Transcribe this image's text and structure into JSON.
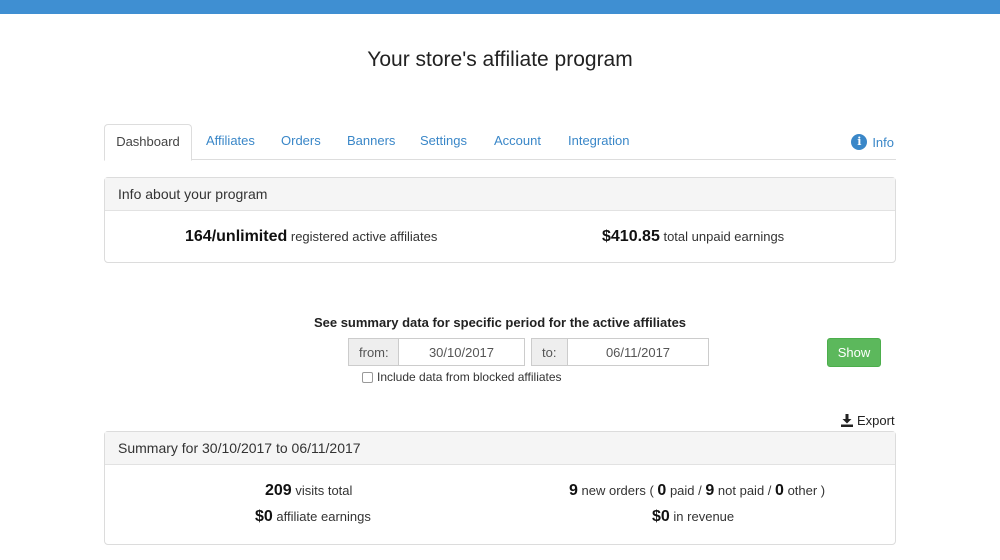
{
  "page": {
    "title": "Your store's affiliate program"
  },
  "tabs": [
    {
      "label": "Dashboard",
      "active": true
    },
    {
      "label": "Affiliates"
    },
    {
      "label": "Orders"
    },
    {
      "label": "Banners"
    },
    {
      "label": "Settings"
    },
    {
      "label": "Account"
    },
    {
      "label": "Integration"
    }
  ],
  "info_link": {
    "label": "Info",
    "icon": "info-circle-icon"
  },
  "program_info": {
    "heading": "Info about your program",
    "affiliates_value": "164/unlimited",
    "affiliates_label": "registered active affiliates",
    "earnings_value": "$410.85",
    "earnings_label": "total unpaid earnings"
  },
  "period_filter": {
    "title": "See summary data for specific period for the active affiliates",
    "from_label": "from:",
    "from_value": "30/10/2017",
    "to_label": "to:",
    "to_value": "06/11/2017",
    "show_label": "Show",
    "include_blocked_label": "Include data from blocked affiliates",
    "include_blocked_checked": false
  },
  "export": {
    "label": "Export",
    "icon": "download-icon"
  },
  "summary": {
    "heading": "Summary for 30/10/2017 to 06/11/2017",
    "visits_value": "209",
    "visits_label": "visits total",
    "earnings_value": "$0",
    "earnings_label": "affiliate earnings",
    "new_orders_value": "9",
    "new_orders_label": "new orders (",
    "paid_value": "0",
    "paid_label": "paid /",
    "not_paid_value": "9",
    "not_paid_label": "not paid /",
    "other_value": "0",
    "other_label": "other )",
    "revenue_value": "$0",
    "revenue_label": "in revenue"
  },
  "colors": {
    "topbar": "#3f8fd2",
    "link": "#3a87c8",
    "show_button": "#5cb85c"
  }
}
